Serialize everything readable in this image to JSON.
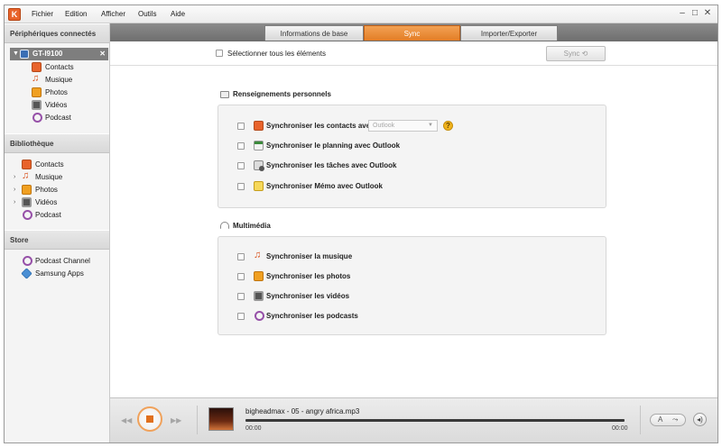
{
  "menu": {
    "logo": "K",
    "items": [
      "Fichier",
      "Edition",
      "Afficher",
      "Outils",
      "Aide"
    ],
    "window_controls": [
      "–",
      "□",
      "✕"
    ]
  },
  "sidebar": {
    "connected_header": "Périphériques connectés",
    "device": {
      "name": "GT-I9100",
      "expand": "▼",
      "close": "✕"
    },
    "device_items": [
      {
        "label": "Contacts",
        "icon": "contacts-icon"
      },
      {
        "label": "Musique",
        "icon": "music-icon"
      },
      {
        "label": "Photos",
        "icon": "photos-icon"
      },
      {
        "label": "Vidéos",
        "icon": "videos-icon"
      },
      {
        "label": "Podcast",
        "icon": "podcast-icon"
      }
    ],
    "library_header": "Bibliothèque",
    "library_items": [
      {
        "label": "Contacts",
        "icon": "contacts-icon",
        "arrow": ""
      },
      {
        "label": "Musique",
        "icon": "music-icon",
        "arrow": "›"
      },
      {
        "label": "Photos",
        "icon": "photos-icon",
        "arrow": "›"
      },
      {
        "label": "Vidéos",
        "icon": "videos-icon",
        "arrow": "›"
      },
      {
        "label": "Podcast",
        "icon": "podcast-icon",
        "arrow": ""
      }
    ],
    "store_header": "Store",
    "store_items": [
      {
        "label": "Podcast Channel",
        "icon": "podcast-icon"
      },
      {
        "label": "Samsung Apps",
        "icon": "apps-icon"
      }
    ]
  },
  "tabs": [
    {
      "label": "Informations de base",
      "active": false
    },
    {
      "label": "Sync",
      "active": true
    },
    {
      "label": "Importer/Exporter",
      "active": false
    }
  ],
  "toolbar": {
    "select_all": "Sélectionner tous les éléments",
    "sync_button": "Sync ⟲"
  },
  "personal": {
    "title": "Renseignements personnels",
    "options": [
      {
        "label": "Synchroniser les contacts avec",
        "icon": "contacts-icon"
      },
      {
        "label": "Synchroniser le planning avec Outlook",
        "icon": "calendar-icon"
      },
      {
        "label": "Synchroniser les tâches avec Outlook",
        "icon": "tasks-icon"
      },
      {
        "label": "Synchroniser Mémo avec Outlook",
        "icon": "memo-icon"
      }
    ],
    "contacts_target": "Outlook",
    "dropdown_arrow": "▼",
    "help": "?"
  },
  "multimedia": {
    "title": "Multimédia",
    "options": [
      {
        "label": "Synchroniser la musique",
        "icon": "music-icon"
      },
      {
        "label": "Synchroniser les photos",
        "icon": "photos-icon"
      },
      {
        "label": "Synchroniser les vidéos",
        "icon": "videos-icon"
      },
      {
        "label": "Synchroniser les podcasts",
        "icon": "podcast-icon"
      }
    ]
  },
  "player": {
    "prev": "◀◀",
    "next": "▶▶",
    "track": "bigheadmax - 05 - angry africa.mp3",
    "current_time": "00:00",
    "total_time": "00:00",
    "progress": 0.0,
    "repeat_icon": "A",
    "shuffle_icon": "⤳",
    "volume_icon": "◂)"
  },
  "colors": {
    "accent": "#e8632b",
    "tab_active": "#e37d25",
    "device_row": "#7e7e7e"
  }
}
